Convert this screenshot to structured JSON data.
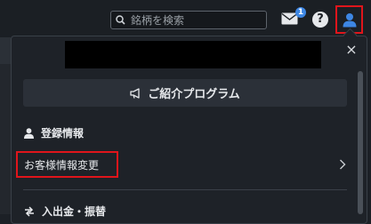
{
  "header": {
    "search_placeholder": "銘柄を検索",
    "notification_count": "1",
    "help_label": "?"
  },
  "panel": {
    "close_label": "×",
    "intro_button_label": "ご紹介プログラム",
    "registration_section_title": "登録情報",
    "customer_info_change_label": "お客様情報変更",
    "deposit_section_title": "入出金・振替"
  },
  "colors": {
    "highlight": "#e0151b",
    "badge": "#3d86e3",
    "user_icon": "#3d86e3"
  }
}
